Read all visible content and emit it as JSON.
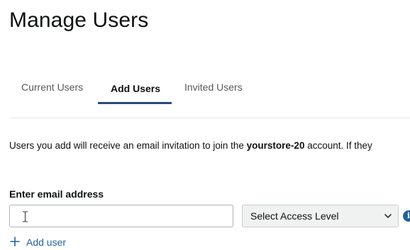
{
  "header": {
    "title": "Manage Users"
  },
  "tabs": [
    {
      "label": "Current Users",
      "active": false
    },
    {
      "label": "Add Users",
      "active": true
    },
    {
      "label": "Invited Users",
      "active": false
    }
  ],
  "intro": {
    "prefix": "Users you add will receive an email invitation to join the ",
    "account_name": "yourstore-20",
    "suffix": " account. If they"
  },
  "form": {
    "email_label": "Enter email address",
    "email_value": "",
    "email_placeholder": "",
    "access_select_value": "Select Access Level",
    "add_user_label": "Add user",
    "info_icon_glyph": "i"
  },
  "icons": {
    "chevron": "chevron-down-icon",
    "info": "info-icon",
    "plus": "plus-icon"
  },
  "colors": {
    "link": "#2162a1",
    "active_tab_underline": "#2a4a7a",
    "text": "#0f1111",
    "muted_text": "#565959"
  }
}
